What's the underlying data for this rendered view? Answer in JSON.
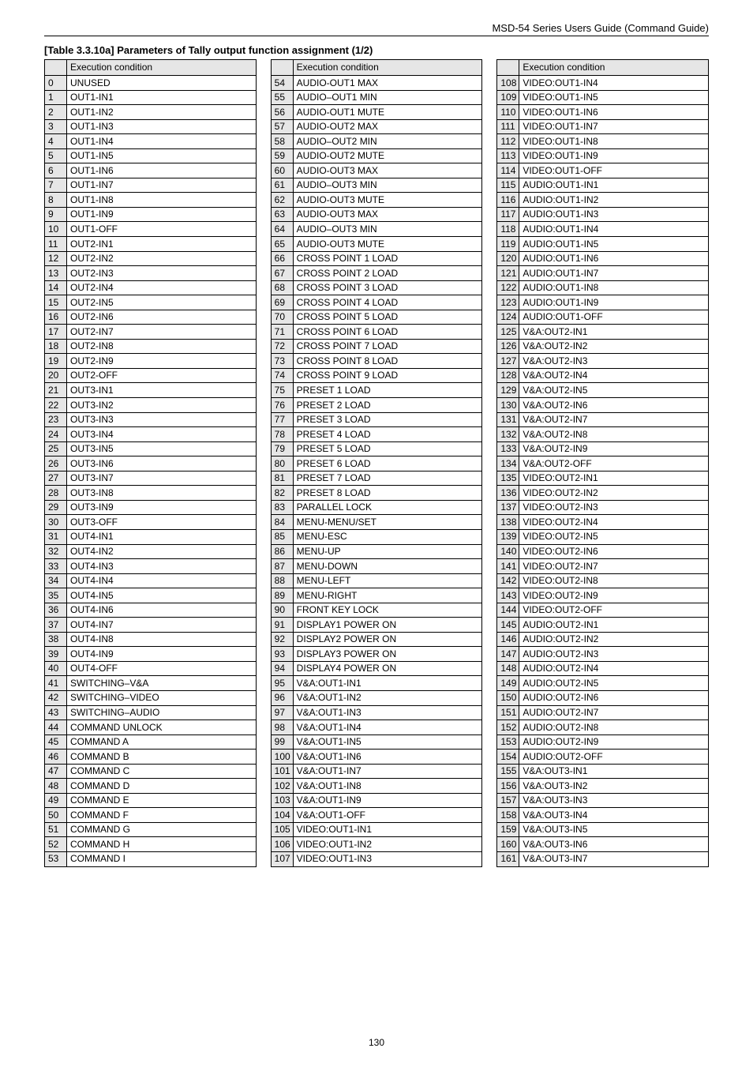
{
  "doc_header": "MSD-54 Series Users Guide (Command Guide)",
  "table_title": "[Table 3.3.10a] Parameters of Tally output function assignment (1/2)",
  "page_number": "130",
  "columns_header": {
    "blank": "",
    "condition": "Execution condition"
  },
  "col1": [
    {
      "n": "0",
      "t": "UNUSED"
    },
    {
      "n": "1",
      "t": "OUT1-IN1"
    },
    {
      "n": "2",
      "t": "OUT1-IN2"
    },
    {
      "n": "3",
      "t": "OUT1-IN3"
    },
    {
      "n": "4",
      "t": "OUT1-IN4"
    },
    {
      "n": "5",
      "t": "OUT1-IN5"
    },
    {
      "n": "6",
      "t": "OUT1-IN6"
    },
    {
      "n": "7",
      "t": "OUT1-IN7"
    },
    {
      "n": "8",
      "t": "OUT1-IN8"
    },
    {
      "n": "9",
      "t": "OUT1-IN9"
    },
    {
      "n": "10",
      "t": "OUT1-OFF"
    },
    {
      "n": "11",
      "t": "OUT2-IN1"
    },
    {
      "n": "12",
      "t": "OUT2-IN2"
    },
    {
      "n": "13",
      "t": "OUT2-IN3"
    },
    {
      "n": "14",
      "t": "OUT2-IN4"
    },
    {
      "n": "15",
      "t": "OUT2-IN5"
    },
    {
      "n": "16",
      "t": "OUT2-IN6"
    },
    {
      "n": "17",
      "t": "OUT2-IN7"
    },
    {
      "n": "18",
      "t": "OUT2-IN8"
    },
    {
      "n": "19",
      "t": "OUT2-IN9"
    },
    {
      "n": "20",
      "t": "OUT2-OFF"
    },
    {
      "n": "21",
      "t": "OUT3-IN1"
    },
    {
      "n": "22",
      "t": "OUT3-IN2"
    },
    {
      "n": "23",
      "t": "OUT3-IN3"
    },
    {
      "n": "24",
      "t": "OUT3-IN4"
    },
    {
      "n": "25",
      "t": "OUT3-IN5"
    },
    {
      "n": "26",
      "t": "OUT3-IN6"
    },
    {
      "n": "27",
      "t": "OUT3-IN7"
    },
    {
      "n": "28",
      "t": "OUT3-IN8"
    },
    {
      "n": "29",
      "t": "OUT3-IN9"
    },
    {
      "n": "30",
      "t": "OUT3-OFF"
    },
    {
      "n": "31",
      "t": "OUT4-IN1"
    },
    {
      "n": "32",
      "t": "OUT4-IN2"
    },
    {
      "n": "33",
      "t": "OUT4-IN3"
    },
    {
      "n": "34",
      "t": "OUT4-IN4"
    },
    {
      "n": "35",
      "t": "OUT4-IN5"
    },
    {
      "n": "36",
      "t": "OUT4-IN6"
    },
    {
      "n": "37",
      "t": "OUT4-IN7"
    },
    {
      "n": "38",
      "t": "OUT4-IN8"
    },
    {
      "n": "39",
      "t": "OUT4-IN9"
    },
    {
      "n": "40",
      "t": "OUT4-OFF"
    },
    {
      "n": "41",
      "t": "SWITCHING–V&A"
    },
    {
      "n": "42",
      "t": "SWITCHING–VIDEO"
    },
    {
      "n": "43",
      "t": "SWITCHING–AUDIO"
    },
    {
      "n": "44",
      "t": "COMMAND UNLOCK"
    },
    {
      "n": "45",
      "t": "COMMAND A"
    },
    {
      "n": "46",
      "t": "COMMAND B"
    },
    {
      "n": "47",
      "t": "COMMAND C"
    },
    {
      "n": "48",
      "t": "COMMAND D"
    },
    {
      "n": "49",
      "t": "COMMAND E"
    },
    {
      "n": "50",
      "t": "COMMAND F"
    },
    {
      "n": "51",
      "t": "COMMAND G"
    },
    {
      "n": "52",
      "t": "COMMAND H"
    },
    {
      "n": "53",
      "t": "COMMAND I"
    }
  ],
  "col2": [
    {
      "n": "54",
      "t": "AUDIO-OUT1 MAX"
    },
    {
      "n": "55",
      "t": "AUDIO–OUT1 MIN"
    },
    {
      "n": "56",
      "t": "AUDIO-OUT1 MUTE"
    },
    {
      "n": "57",
      "t": "AUDIO-OUT2 MAX"
    },
    {
      "n": "58",
      "t": "AUDIO–OUT2 MIN"
    },
    {
      "n": "59",
      "t": "AUDIO-OUT2 MUTE"
    },
    {
      "n": "60",
      "t": "AUDIO-OUT3 MAX"
    },
    {
      "n": "61",
      "t": "AUDIO–OUT3 MIN"
    },
    {
      "n": "62",
      "t": "AUDIO-OUT3 MUTE"
    },
    {
      "n": "63",
      "t": "AUDIO-OUT3 MAX"
    },
    {
      "n": "64",
      "t": "AUDIO–OUT3 MIN"
    },
    {
      "n": "65",
      "t": "AUDIO-OUT3 MUTE"
    },
    {
      "n": "66",
      "t": "CROSS POINT 1 LOAD"
    },
    {
      "n": "67",
      "t": "CROSS POINT 2 LOAD"
    },
    {
      "n": "68",
      "t": "CROSS POINT 3 LOAD"
    },
    {
      "n": "69",
      "t": "CROSS POINT 4 LOAD"
    },
    {
      "n": "70",
      "t": "CROSS POINT 5 LOAD"
    },
    {
      "n": "71",
      "t": "CROSS POINT 6 LOAD"
    },
    {
      "n": "72",
      "t": "CROSS POINT 7 LOAD"
    },
    {
      "n": "73",
      "t": "CROSS POINT 8 LOAD"
    },
    {
      "n": "74",
      "t": "CROSS POINT 9 LOAD"
    },
    {
      "n": "75",
      "t": "PRESET 1 LOAD"
    },
    {
      "n": "76",
      "t": "PRESET 2 LOAD"
    },
    {
      "n": "77",
      "t": "PRESET 3 LOAD"
    },
    {
      "n": "78",
      "t": "PRESET 4 LOAD"
    },
    {
      "n": "79",
      "t": "PRESET 5 LOAD"
    },
    {
      "n": "80",
      "t": "PRESET 6 LOAD"
    },
    {
      "n": "81",
      "t": "PRESET 7 LOAD"
    },
    {
      "n": "82",
      "t": "PRESET 8 LOAD"
    },
    {
      "n": "83",
      "t": "PARALLEL LOCK"
    },
    {
      "n": "84",
      "t": "MENU-MENU/SET"
    },
    {
      "n": "85",
      "t": "MENU-ESC"
    },
    {
      "n": "86",
      "t": "MENU-UP"
    },
    {
      "n": "87",
      "t": "MENU-DOWN"
    },
    {
      "n": "88",
      "t": "MENU-LEFT"
    },
    {
      "n": "89",
      "t": "MENU-RIGHT"
    },
    {
      "n": "90",
      "t": "FRONT KEY LOCK"
    },
    {
      "n": "91",
      "t": "DISPLAY1 POWER ON"
    },
    {
      "n": "92",
      "t": "DISPLAY2 POWER ON"
    },
    {
      "n": "93",
      "t": "DISPLAY3 POWER ON"
    },
    {
      "n": "94",
      "t": "DISPLAY4 POWER ON"
    },
    {
      "n": "95",
      "t": "V&A:OUT1-IN1"
    },
    {
      "n": "96",
      "t": "V&A:OUT1-IN2"
    },
    {
      "n": "97",
      "t": "V&A:OUT1-IN3"
    },
    {
      "n": "98",
      "t": "V&A:OUT1-IN4"
    },
    {
      "n": "99",
      "t": "V&A:OUT1-IN5"
    },
    {
      "n": "100",
      "t": "V&A:OUT1-IN6"
    },
    {
      "n": "101",
      "t": "V&A:OUT1-IN7"
    },
    {
      "n": "102",
      "t": "V&A:OUT1-IN8"
    },
    {
      "n": "103",
      "t": "V&A:OUT1-IN9"
    },
    {
      "n": "104",
      "t": "V&A:OUT1-OFF"
    },
    {
      "n": "105",
      "t": "VIDEO:OUT1-IN1"
    },
    {
      "n": "106",
      "t": "VIDEO:OUT1-IN2"
    },
    {
      "n": "107",
      "t": "VIDEO:OUT1-IN3"
    }
  ],
  "col3": [
    {
      "n": "108",
      "t": "VIDEO:OUT1-IN4"
    },
    {
      "n": "109",
      "t": "VIDEO:OUT1-IN5"
    },
    {
      "n": "110",
      "t": "VIDEO:OUT1-IN6"
    },
    {
      "n": "111",
      "t": "VIDEO:OUT1-IN7"
    },
    {
      "n": "112",
      "t": "VIDEO:OUT1-IN8"
    },
    {
      "n": "113",
      "t": "VIDEO:OUT1-IN9"
    },
    {
      "n": "114",
      "t": "VIDEO:OUT1-OFF"
    },
    {
      "n": "115",
      "t": "AUDIO:OUT1-IN1"
    },
    {
      "n": "116",
      "t": "AUDIO:OUT1-IN2"
    },
    {
      "n": "117",
      "t": "AUDIO:OUT1-IN3"
    },
    {
      "n": "118",
      "t": "AUDIO:OUT1-IN4"
    },
    {
      "n": "119",
      "t": "AUDIO:OUT1-IN5"
    },
    {
      "n": "120",
      "t": "AUDIO:OUT1-IN6"
    },
    {
      "n": "121",
      "t": "AUDIO:OUT1-IN7"
    },
    {
      "n": "122",
      "t": "AUDIO:OUT1-IN8"
    },
    {
      "n": "123",
      "t": "AUDIO:OUT1-IN9"
    },
    {
      "n": "124",
      "t": "AUDIO:OUT1-OFF"
    },
    {
      "n": "125",
      "t": "V&A:OUT2-IN1"
    },
    {
      "n": "126",
      "t": "V&A:OUT2-IN2"
    },
    {
      "n": "127",
      "t": "V&A:OUT2-IN3"
    },
    {
      "n": "128",
      "t": "V&A:OUT2-IN4"
    },
    {
      "n": "129",
      "t": "V&A:OUT2-IN5"
    },
    {
      "n": "130",
      "t": "V&A:OUT2-IN6"
    },
    {
      "n": "131",
      "t": "V&A:OUT2-IN7"
    },
    {
      "n": "132",
      "t": "V&A:OUT2-IN8"
    },
    {
      "n": "133",
      "t": "V&A:OUT2-IN9"
    },
    {
      "n": "134",
      "t": "V&A:OUT2-OFF"
    },
    {
      "n": "135",
      "t": "VIDEO:OUT2-IN1"
    },
    {
      "n": "136",
      "t": "VIDEO:OUT2-IN2"
    },
    {
      "n": "137",
      "t": "VIDEO:OUT2-IN3"
    },
    {
      "n": "138",
      "t": "VIDEO:OUT2-IN4"
    },
    {
      "n": "139",
      "t": "VIDEO:OUT2-IN5"
    },
    {
      "n": "140",
      "t": "VIDEO:OUT2-IN6"
    },
    {
      "n": "141",
      "t": "VIDEO:OUT2-IN7"
    },
    {
      "n": "142",
      "t": "VIDEO:OUT2-IN8"
    },
    {
      "n": "143",
      "t": "VIDEO:OUT2-IN9"
    },
    {
      "n": "144",
      "t": "VIDEO:OUT2-OFF"
    },
    {
      "n": "145",
      "t": "AUDIO:OUT2-IN1"
    },
    {
      "n": "146",
      "t": "AUDIO:OUT2-IN2"
    },
    {
      "n": "147",
      "t": "AUDIO:OUT2-IN3"
    },
    {
      "n": "148",
      "t": "AUDIO:OUT2-IN4"
    },
    {
      "n": "149",
      "t": "AUDIO:OUT2-IN5"
    },
    {
      "n": "150",
      "t": "AUDIO:OUT2-IN6"
    },
    {
      "n": "151",
      "t": "AUDIO:OUT2-IN7"
    },
    {
      "n": "152",
      "t": "AUDIO:OUT2-IN8"
    },
    {
      "n": "153",
      "t": "AUDIO:OUT2-IN9"
    },
    {
      "n": "154",
      "t": "AUDIO:OUT2-OFF"
    },
    {
      "n": "155",
      "t": "V&A:OUT3-IN1"
    },
    {
      "n": "156",
      "t": "V&A:OUT3-IN2"
    },
    {
      "n": "157",
      "t": "V&A:OUT3-IN3"
    },
    {
      "n": "158",
      "t": "V&A:OUT3-IN4"
    },
    {
      "n": "159",
      "t": "V&A:OUT3-IN5"
    },
    {
      "n": "160",
      "t": "V&A:OUT3-IN6"
    },
    {
      "n": "161",
      "t": "V&A:OUT3-IN7"
    }
  ]
}
